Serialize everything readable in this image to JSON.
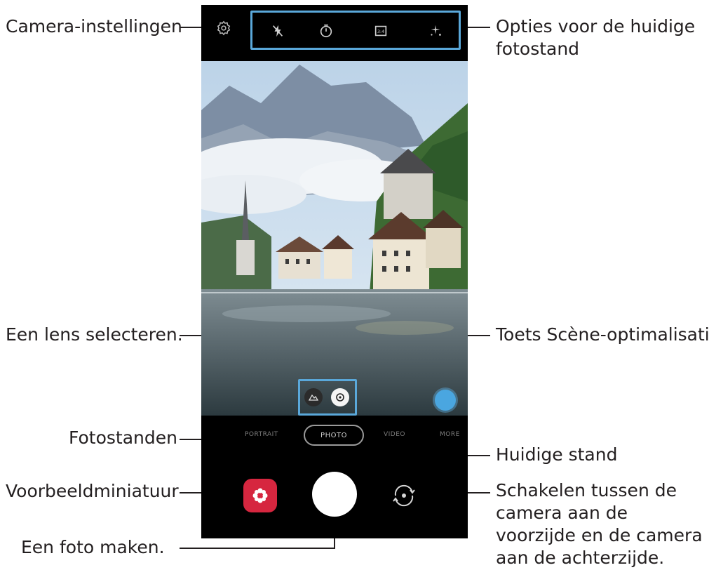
{
  "callouts": {
    "camera_settings": "Camera-instellingen",
    "options": "Opties voor de huidige fotostand",
    "select_lens": "Een lens selecteren.",
    "scene_optimizer": "Toets Scène-optimalisatie",
    "modes": "Fotostanden",
    "current_mode": "Huidige stand",
    "preview_thumbnail": "Voorbeeldminiatuur",
    "switch_cameras": "Schakelen tussen de camera aan de voorzijde en de camera aan de achterzijde.",
    "take_photo": "Een foto maken."
  },
  "camera": {
    "mode_items": [
      "PORTRAIT",
      "PHOTO",
      "VIDEO",
      "MORE"
    ],
    "current_mode": "PHOTO"
  },
  "icons": {
    "settings": "gear-icon",
    "options": [
      "flash-off-icon",
      "timer-icon",
      "aspect-ratio-icon",
      "effects-icon"
    ],
    "lenses": [
      "ultra-wide-lens-icon",
      "wide-lens-icon"
    ],
    "scene_optimizer": "scene-optimizer-icon",
    "thumbnail": "gallery-thumbnail-icon",
    "shutter": "shutter-icon",
    "switch": "switch-camera-icon"
  },
  "colors": {
    "highlight": "#5aa8da",
    "scene_button": "#4aa6e0",
    "thumbnail": "#d6263f"
  }
}
